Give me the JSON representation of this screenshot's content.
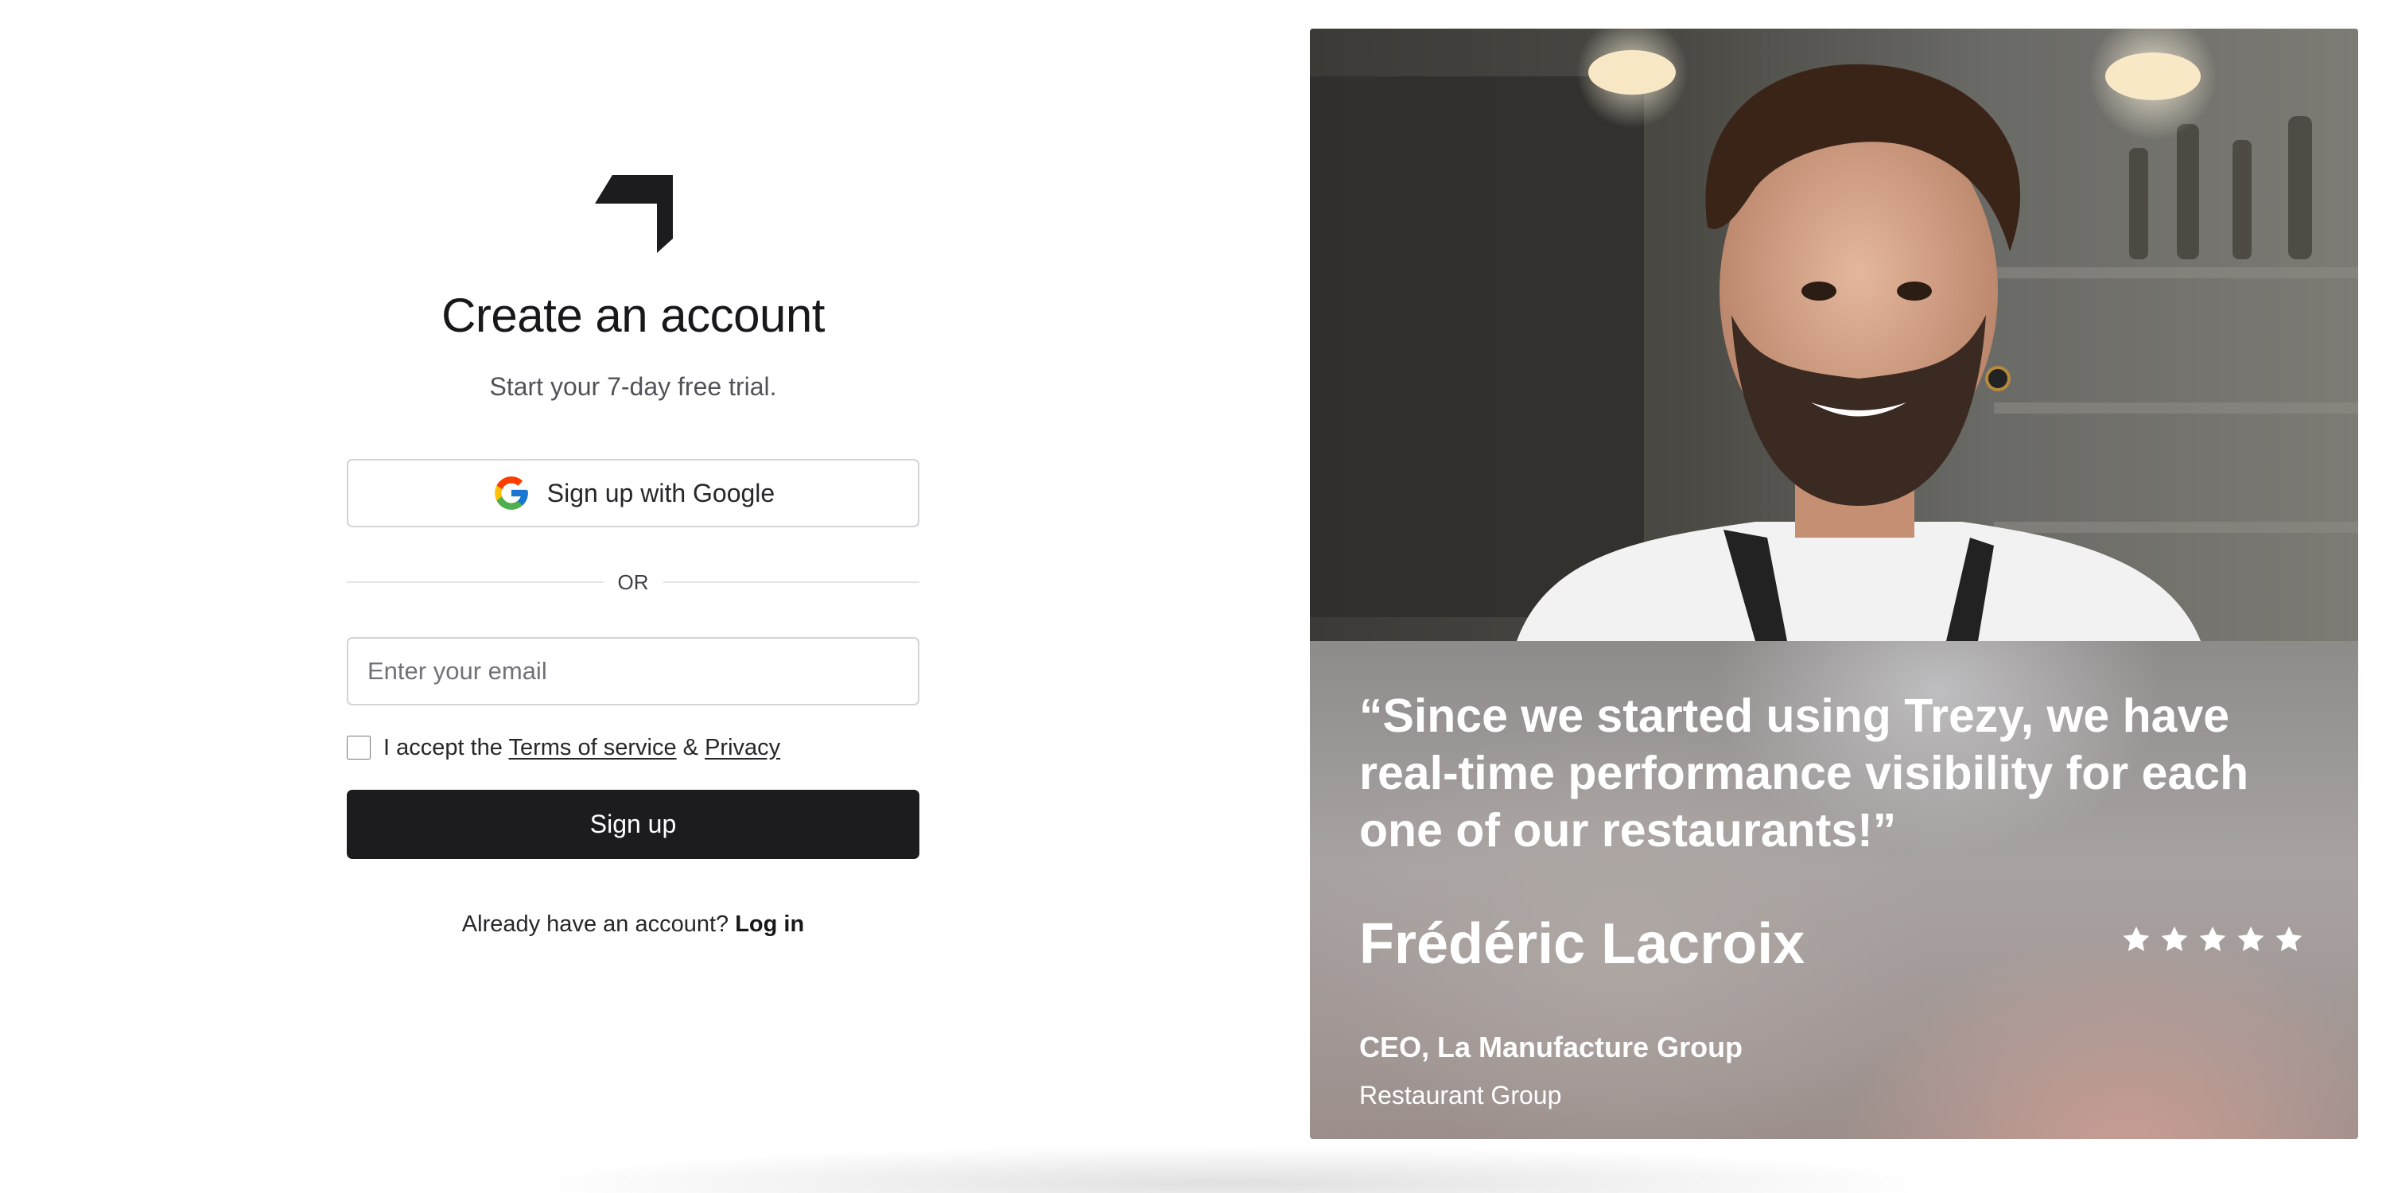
{
  "signup": {
    "title": "Create an account",
    "subtitle": "Start your 7-day free trial.",
    "google_button_label": "Sign up with Google",
    "divider_label": "OR",
    "email_placeholder": "Enter your email",
    "terms": {
      "prefix": "I accept the",
      "terms_link": "Terms of service",
      "separator": "&",
      "privacy_link": "Privacy",
      "checked": false
    },
    "submit_label": "Sign up",
    "login_prompt": "Already have an account?",
    "login_link": "Log in"
  },
  "testimonial": {
    "quote": "“Since we started using Trezy, we have real-time performance visibility for each one of our restaurants!”",
    "author_name": "Frédéric Lacroix",
    "author_role": "CEO, La Manufacture Group",
    "author_company": "Restaurant Group",
    "rating": 5,
    "rating_max": 5
  },
  "icons": {
    "logo": "brand-logo-icon",
    "google": "google-icon",
    "star": "star-icon"
  },
  "colors": {
    "primary_button": "#1c1c1e",
    "border": "#d4d4d8",
    "text_muted": "#52525b"
  }
}
